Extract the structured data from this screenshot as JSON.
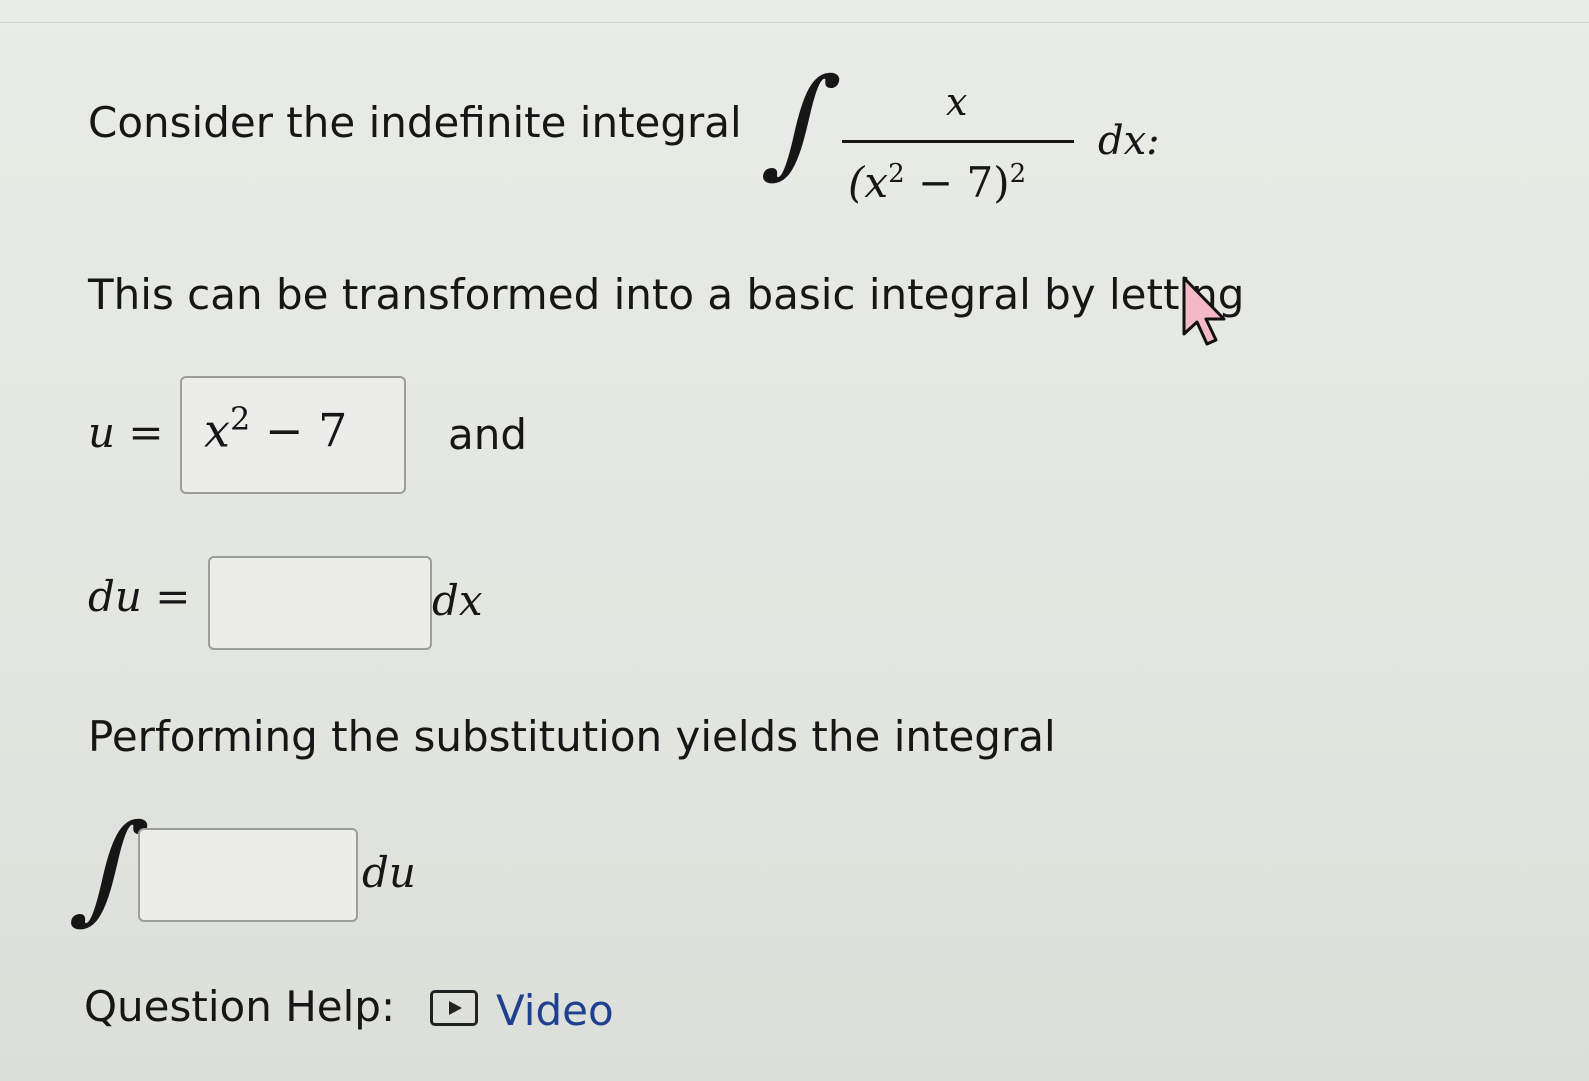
{
  "problem": {
    "intro": "Consider the indefinite integral",
    "integral": {
      "integral_sign": "∫",
      "numerator": "x",
      "denominator_base": "(x",
      "denominator_inner_exp": "2",
      "denominator_rest": " − 7)",
      "denominator_outer_exp": "2",
      "differential": "dx:"
    },
    "transform_text": "This can be transformed into a basic integral by letting"
  },
  "u_row": {
    "lhs": "u =",
    "value_base": "x",
    "value_exp": "2",
    "value_rest": " − 7",
    "connector": "and"
  },
  "du_row": {
    "lhs": "du =",
    "value": "",
    "suffix": "dx"
  },
  "substitution": {
    "text": "Performing the substitution yields the integral",
    "integral_sign": "∫",
    "value": "",
    "suffix": "du"
  },
  "help": {
    "label": "Question Help:",
    "video_label": "Video",
    "video_icon": "play-video-icon"
  },
  "cursor": {
    "icon": "mouse-pointer-icon",
    "color": "#f4b9c6"
  }
}
